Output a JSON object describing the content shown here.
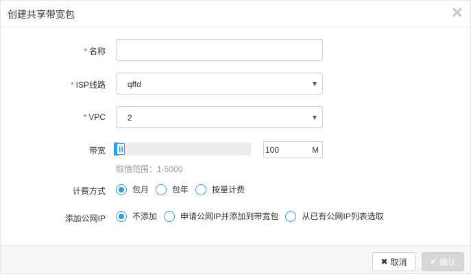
{
  "dialog": {
    "title": "创建共享带宽包",
    "close_icon": "close-icon"
  },
  "form": {
    "required_mark": "*",
    "name": {
      "label": "名称",
      "value": "",
      "placeholder": ""
    },
    "isp": {
      "label": "ISP线路",
      "value": "qffd"
    },
    "vpc": {
      "label": "VPC",
      "value": "2"
    },
    "bandwidth": {
      "label": "带宽",
      "value": "100",
      "unit": "M",
      "range_hint": "取值范围：1-5000",
      "slider_min": 1,
      "slider_max": 5000,
      "slider_value": 100
    },
    "billing": {
      "label": "计费方式",
      "options": [
        "包月",
        "包年",
        "按量计费"
      ],
      "selected": 0
    },
    "public_ip": {
      "label": "添加公网IP",
      "options": [
        "不添加",
        "申请公网IP并添加到带宽包",
        "从已有公网IP列表选取"
      ],
      "selected": 0
    }
  },
  "footer": {
    "cancel_label": "取消",
    "confirm_label": "确认"
  },
  "colors": {
    "accent": "#2d9bf0",
    "required": "#e74c3c",
    "hint": "#999999",
    "disabled_button": "#d7d7d7"
  }
}
